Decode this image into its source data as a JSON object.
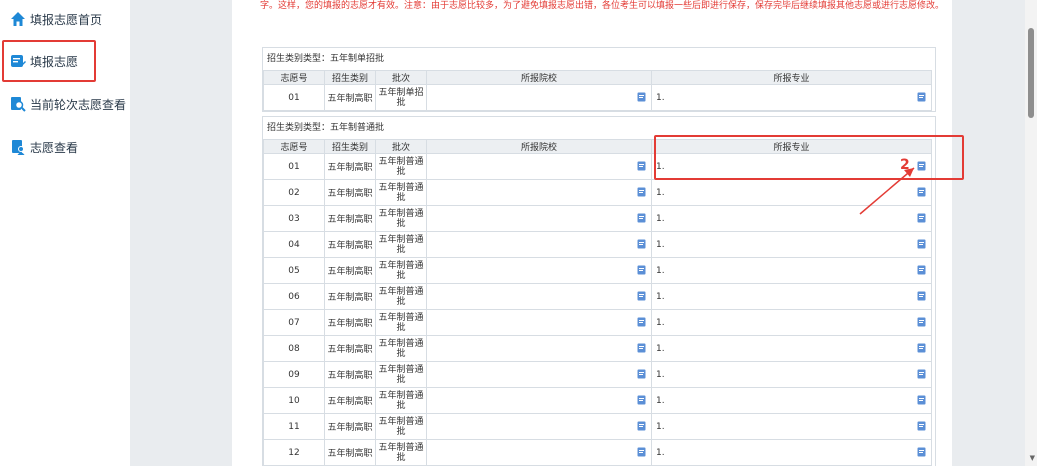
{
  "sidebar": {
    "items": [
      {
        "label": "填报志愿首页",
        "icon": "home-icon"
      },
      {
        "label": "填报志愿",
        "icon": "edit-form-icon"
      },
      {
        "label": "当前轮次志愿查看",
        "icon": "search-doc-icon"
      },
      {
        "label": "志愿查看",
        "icon": "user-doc-icon"
      }
    ]
  },
  "notice": "字。这样，您的填报的志愿才有效。注意：由于志愿比较多，为了避免填报志愿出错，各位考生可以填报一些后即进行保存，保存完毕后继续填报其他志愿或进行志愿修改。",
  "sections": [
    {
      "title": "招生类别类型：五年制单招批",
      "headers": [
        "志愿号",
        "招生类别",
        "批次",
        "所报院校",
        "所报专业"
      ],
      "rows": [
        {
          "no": "01",
          "category": "五年制高职",
          "batch": "五年制单招批",
          "major_prefix": "1."
        }
      ]
    },
    {
      "title": "招生类别类型：五年制普通批",
      "headers": [
        "志愿号",
        "招生类别",
        "批次",
        "所报院校",
        "所报专业"
      ],
      "rows": [
        {
          "no": "01",
          "category": "五年制高职",
          "batch": "五年制普通批",
          "major_prefix": "1."
        },
        {
          "no": "02",
          "category": "五年制高职",
          "batch": "五年制普通批",
          "major_prefix": "1."
        },
        {
          "no": "03",
          "category": "五年制高职",
          "batch": "五年制普通批",
          "major_prefix": "1."
        },
        {
          "no": "04",
          "category": "五年制高职",
          "batch": "五年制普通批",
          "major_prefix": "1."
        },
        {
          "no": "05",
          "category": "五年制高职",
          "batch": "五年制普通批",
          "major_prefix": "1."
        },
        {
          "no": "06",
          "category": "五年制高职",
          "batch": "五年制普通批",
          "major_prefix": "1."
        },
        {
          "no": "07",
          "category": "五年制高职",
          "batch": "五年制普通批",
          "major_prefix": "1."
        },
        {
          "no": "08",
          "category": "五年制高职",
          "batch": "五年制普通批",
          "major_prefix": "1."
        },
        {
          "no": "09",
          "category": "五年制高职",
          "batch": "五年制普通批",
          "major_prefix": "1."
        },
        {
          "no": "10",
          "category": "五年制高职",
          "batch": "五年制普通批",
          "major_prefix": "1."
        },
        {
          "no": "11",
          "category": "五年制高职",
          "batch": "五年制普通批",
          "major_prefix": "1."
        },
        {
          "no": "12",
          "category": "五年制高职",
          "batch": "五年制普通批",
          "major_prefix": "1."
        }
      ]
    }
  ],
  "annotation": {
    "step_number": "2"
  },
  "colors": {
    "accent": "#e33b35",
    "icon_blue": "#1e88d6"
  }
}
